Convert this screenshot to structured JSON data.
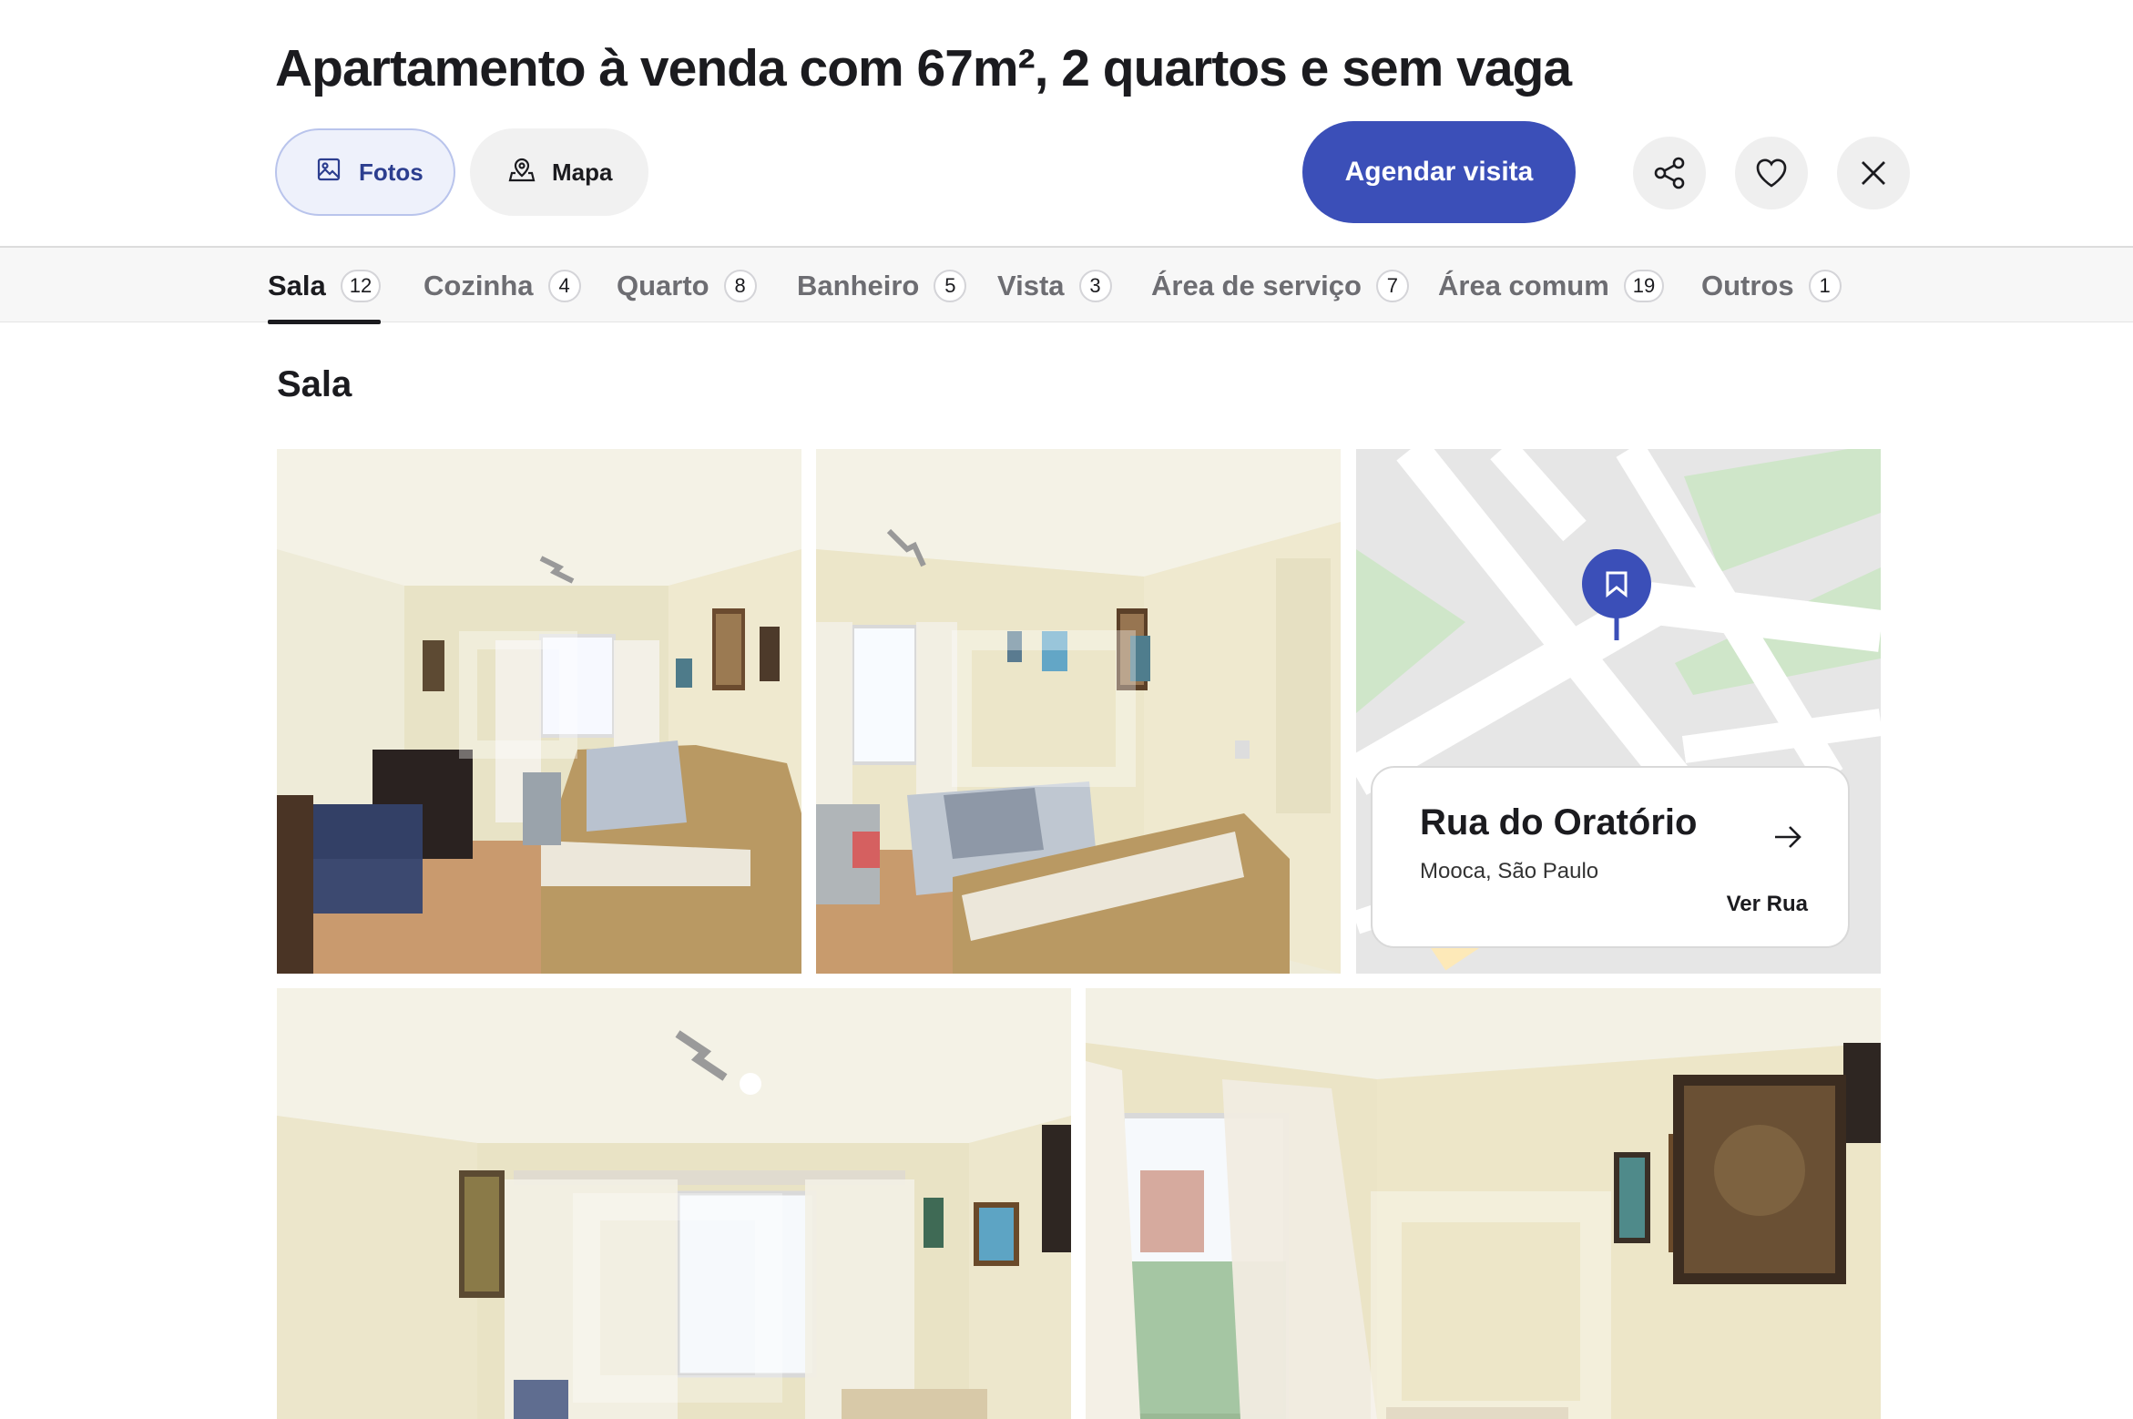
{
  "header": {
    "title": "Apartamento à venda com 67m², 2 quartos e sem vaga",
    "buttons": {
      "fotos": "Fotos",
      "mapa": "Mapa",
      "schedule": "Agendar visita"
    },
    "icons": [
      "image-icon",
      "map-pin-icon",
      "share-icon",
      "heart-icon",
      "close-icon"
    ],
    "accent_color": "#3b4fb8"
  },
  "tabs": [
    {
      "label": "Sala",
      "count": "12",
      "active": true
    },
    {
      "label": "Cozinha",
      "count": "4"
    },
    {
      "label": "Quarto",
      "count": "8"
    },
    {
      "label": "Banheiro",
      "count": "5"
    },
    {
      "label": "Vista",
      "count": "3"
    },
    {
      "label": "Área de serviço",
      "count": "7"
    },
    {
      "label": "Área comum",
      "count": "19"
    },
    {
      "label": "Outros",
      "count": "1"
    }
  ],
  "section": {
    "title": "Sala"
  },
  "map_card": {
    "street": "Rua do Oratório",
    "neighborhood": "Mooca, São Paulo",
    "link": "Ver Rua"
  }
}
